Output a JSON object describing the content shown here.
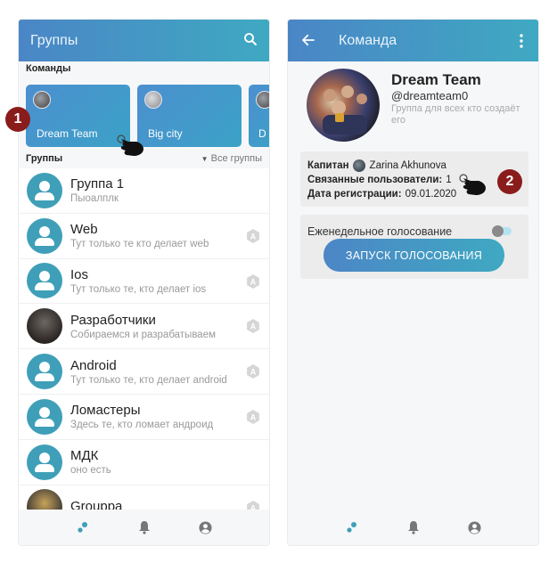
{
  "colors": {
    "accent": "#3f9fb8",
    "appbar_start": "#4a86c6",
    "appbar_end": "#3fa9c2",
    "callout": "#8b1c1c"
  },
  "screen1": {
    "title": "Группы",
    "search_icon": "search-icon",
    "teams_label": "Команды",
    "teams": [
      {
        "name": "Dream Team"
      },
      {
        "name": "Big city"
      },
      {
        "name": "D"
      }
    ],
    "groups_label": "Группы",
    "all_groups": "Все группы",
    "groups": [
      {
        "title": "Группа 1",
        "subtitle": "Пыоалплк",
        "avatar": "default",
        "admin": false
      },
      {
        "title": "Web",
        "subtitle": "Тут только те кто делает web",
        "avatar": "default",
        "admin": true
      },
      {
        "title": "Ios",
        "subtitle": "Тут только те, кто делает ios",
        "avatar": "default",
        "admin": true
      },
      {
        "title": "Разработчики",
        "subtitle": "Собираемся и разрабатываем",
        "avatar": "photo",
        "admin": true
      },
      {
        "title": "Android",
        "subtitle": "Тут только те, кто делает android",
        "avatar": "default",
        "admin": true
      },
      {
        "title": "Ломастеры",
        "subtitle": "Здесь те, кто ломает андроид",
        "avatar": "default",
        "admin": true
      },
      {
        "title": "МДК",
        "subtitle": "оно есть",
        "avatar": "default",
        "admin": false
      },
      {
        "title": "Grouppa",
        "subtitle": "",
        "avatar": "photo2",
        "admin": true
      }
    ],
    "admin_badge_letter": "A",
    "callout_number": "1"
  },
  "screen2": {
    "title": "Команда",
    "team_name": "Dream Team",
    "team_handle": "@dreamteam0",
    "team_desc": "Группа для всех кто создаёт его",
    "captain_label": "Капитан",
    "captain_name": "Zarina Akhunova",
    "linked_label": "Связанные пользователи:",
    "linked_value": "1",
    "reg_label": "Дата регистрации:",
    "reg_value": "09.01.2020",
    "weekly_vote": "Еженедельное голосование",
    "vote_button": "ЗАПУСК ГОЛОСОВАНИЯ",
    "callout_number": "2"
  }
}
